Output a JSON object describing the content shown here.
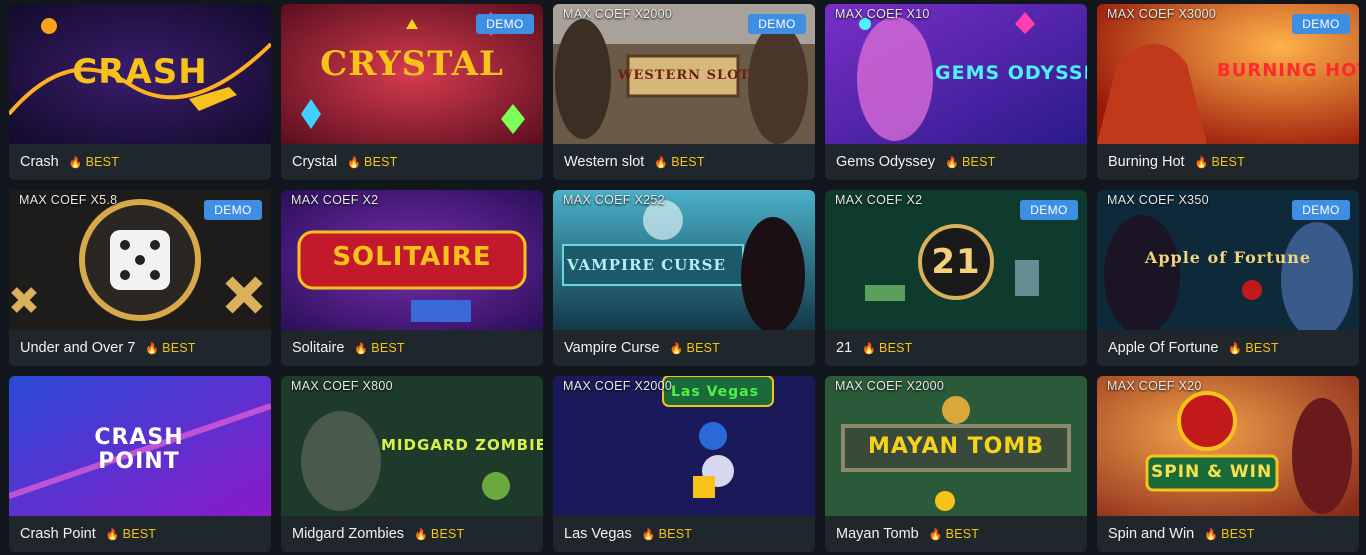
{
  "badge_label": "BEST",
  "demo_label": "DEMO",
  "games": [
    {
      "name": "Crash",
      "coef": "",
      "demo": false,
      "art": "CRASH"
    },
    {
      "name": "Crystal",
      "coef": "",
      "demo": true,
      "art": "CRYSTAL"
    },
    {
      "name": "Western slot",
      "coef": "MAX COEF X2000",
      "demo": true,
      "art": "WESTERN SLOT"
    },
    {
      "name": "Gems Odyssey",
      "coef": "MAX COEF X10",
      "demo": false,
      "art": "GEMS ODYSSEY"
    },
    {
      "name": "Burning Hot",
      "coef": "MAX COEF X3000",
      "demo": true,
      "art": "BURNING HOT"
    },
    {
      "name": "Under and Over 7",
      "coef": "MAX COEF X5.8",
      "demo": true,
      "art": ""
    },
    {
      "name": "Solitaire",
      "coef": "MAX COEF X2",
      "demo": false,
      "art": "SOLITAIRE"
    },
    {
      "name": "Vampire Curse",
      "coef": "MAX COEF X252",
      "demo": false,
      "art": "VAMPIRE CURSE"
    },
    {
      "name": "21",
      "coef": "MAX COEF X2",
      "demo": true,
      "art": "21"
    },
    {
      "name": "Apple Of Fortune",
      "coef": "MAX COEF X350",
      "demo": true,
      "art": "Apple of Fortune"
    },
    {
      "name": "Crash Point",
      "coef": "",
      "demo": false,
      "art": "CRASH POINT"
    },
    {
      "name": "Midgard Zombies",
      "coef": "MAX COEF X800",
      "demo": false,
      "art": "MIDGARD ZOMBIES"
    },
    {
      "name": "Las Vegas",
      "coef": "MAX COEF X2000",
      "demo": false,
      "art": "Las Vegas"
    },
    {
      "name": "Mayan Tomb",
      "coef": "MAX COEF X2000",
      "demo": false,
      "art": "MAYAN TOMB"
    },
    {
      "name": "Spin and Win",
      "coef": "MAX COEF X20",
      "demo": false,
      "art": "SPIN & WIN"
    }
  ],
  "colors": {
    "background": "#11171c",
    "card": "#1f262c",
    "demo_badge": "#3e8ee3",
    "best_badge": "#f2c516"
  }
}
